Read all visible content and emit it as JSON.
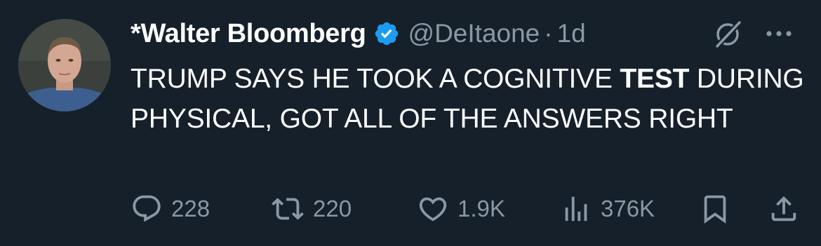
{
  "author": {
    "display_name": "*Walter Bloomberg",
    "handle": "@DeItaone",
    "separator": "·",
    "time": "1d",
    "verified": true,
    "verified_color": "#1d9bf0"
  },
  "tweet": {
    "text_before": "TRUMP SAYS HE TOOK A COGNITIVE ",
    "text_bold": "TEST",
    "text_after": " DURING PHYSICAL, GOT ALL OF THE ANSWERS RIGHT"
  },
  "actions": {
    "replies": "228",
    "reposts": "220",
    "likes": "1.9K",
    "views": "376K"
  },
  "icons": {
    "top_right": [
      "grok-icon",
      "more-icon"
    ],
    "action_bar": [
      "reply-icon",
      "repost-icon",
      "like-icon",
      "views-icon",
      "bookmark-icon",
      "share-icon"
    ]
  },
  "theme": {
    "background": "#15202b",
    "text_primary": "#ffffff",
    "text_secondary": "#8b98a5"
  }
}
